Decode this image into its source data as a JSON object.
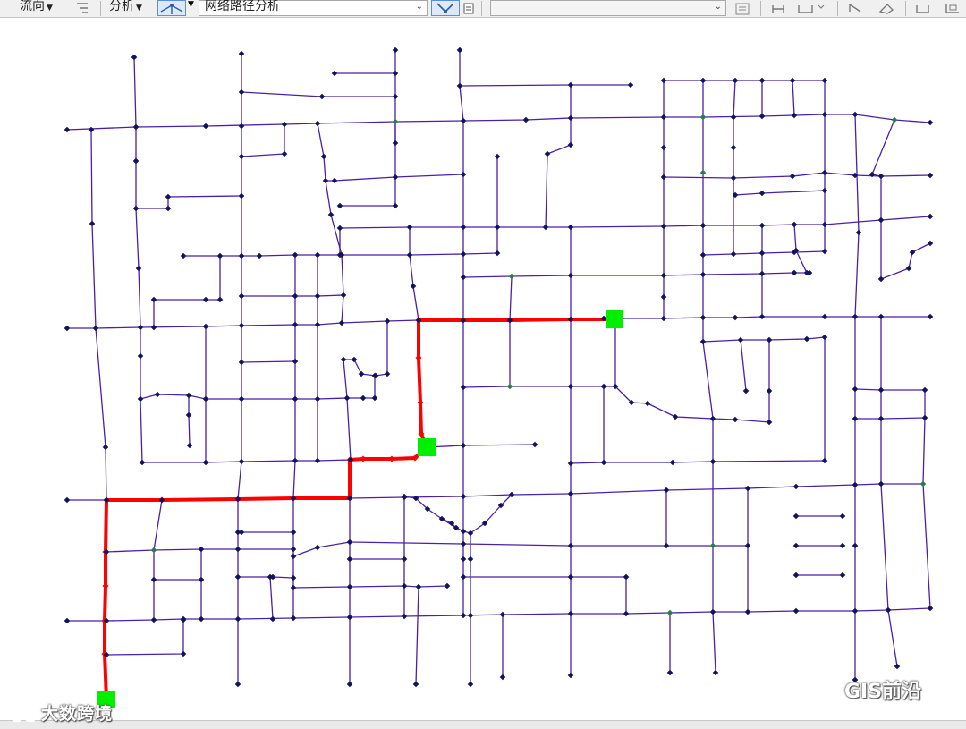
{
  "toolbar": {
    "flow_menu": "流向",
    "analysis_menu": "分析",
    "network_combo": "网络路径分析"
  },
  "map": {
    "colors": {
      "edge": "#4b1fa8",
      "junction": "#13135c",
      "junction_alt": "#2f7a52",
      "route": "#ff0000",
      "flag": "#00ee00"
    }
  },
  "watermarks": {
    "left": "大数跨境",
    "right": "GIS前沿"
  }
}
